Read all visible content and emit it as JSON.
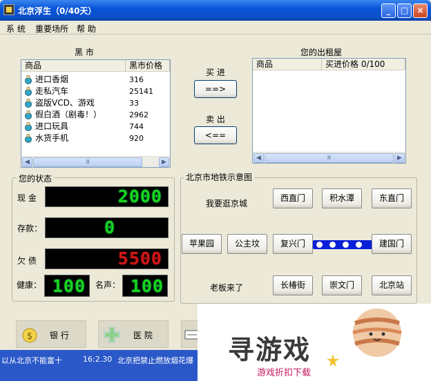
{
  "window": {
    "title": "北京浮生（0/40天）"
  },
  "window_buttons": {
    "minimize": "_",
    "maximize": "□",
    "close": "×"
  },
  "menu": [
    "系 统",
    "重要场所",
    "帮 助"
  ],
  "black_market": {
    "title": "黑 市",
    "columns": [
      "商品",
      "黑市价格"
    ],
    "items": [
      {
        "name": "进口香烟",
        "price": "316"
      },
      {
        "name": "走私汽车",
        "price": "25141"
      },
      {
        "name": "盗版VCD、游戏",
        "price": "33"
      },
      {
        "name": "假白酒（剧毒！）",
        "price": "2962"
      },
      {
        "name": "进口玩具",
        "price": "744"
      },
      {
        "name": "水货手机",
        "price": "920"
      }
    ],
    "scroll_thumb": "Ⅲ"
  },
  "trade": {
    "buy_label": "买 进",
    "buy_button": "==>",
    "sell_label": "卖 出",
    "sell_button": "<=="
  },
  "rental": {
    "title": "您的出租屋",
    "columns": [
      "商品",
      "买进价格 0/100"
    ],
    "scroll_thumb": "Ⅲ"
  },
  "status": {
    "title": "您的状态",
    "cash_label": "现 金",
    "cash": "2000",
    "deposit_label": "存款：",
    "deposit": "0",
    "debt_label": "欠 债",
    "debt": "5500",
    "health_label": "健康：",
    "health": "100",
    "fame_label": "名声：",
    "fame": "100"
  },
  "subway": {
    "title": "北京市地铁示意图",
    "prompt": "我要逛京城",
    "boss_text": "老板来了",
    "stations": {
      "xizhimen": "西直门",
      "jishuitan": "积水潭",
      "dongzhimen": "东直门",
      "pingguoyuan": "苹果园",
      "gongzhufen": "公主坟",
      "fuxingmen": "复兴门",
      "jianguomen": "建国门",
      "changchunjie": "长椿街",
      "chongwenmen": "崇文门",
      "beijingzhan": "北京站"
    }
  },
  "places": {
    "bank": "银 行",
    "hospital": "医 院"
  },
  "status_bar": {
    "text": "以从北京不能富十",
    "time": "16:2.30",
    "news": "北京把禁止燃放烟花爆"
  },
  "watermark": {
    "title": "寻游戏",
    "subtitle": "游戏折扣下载"
  },
  "colors": {
    "titlebar": "#0a55d8",
    "led_green": "#19d41b",
    "led_red": "#d01818",
    "metro_line": "#0a1fd8"
  }
}
